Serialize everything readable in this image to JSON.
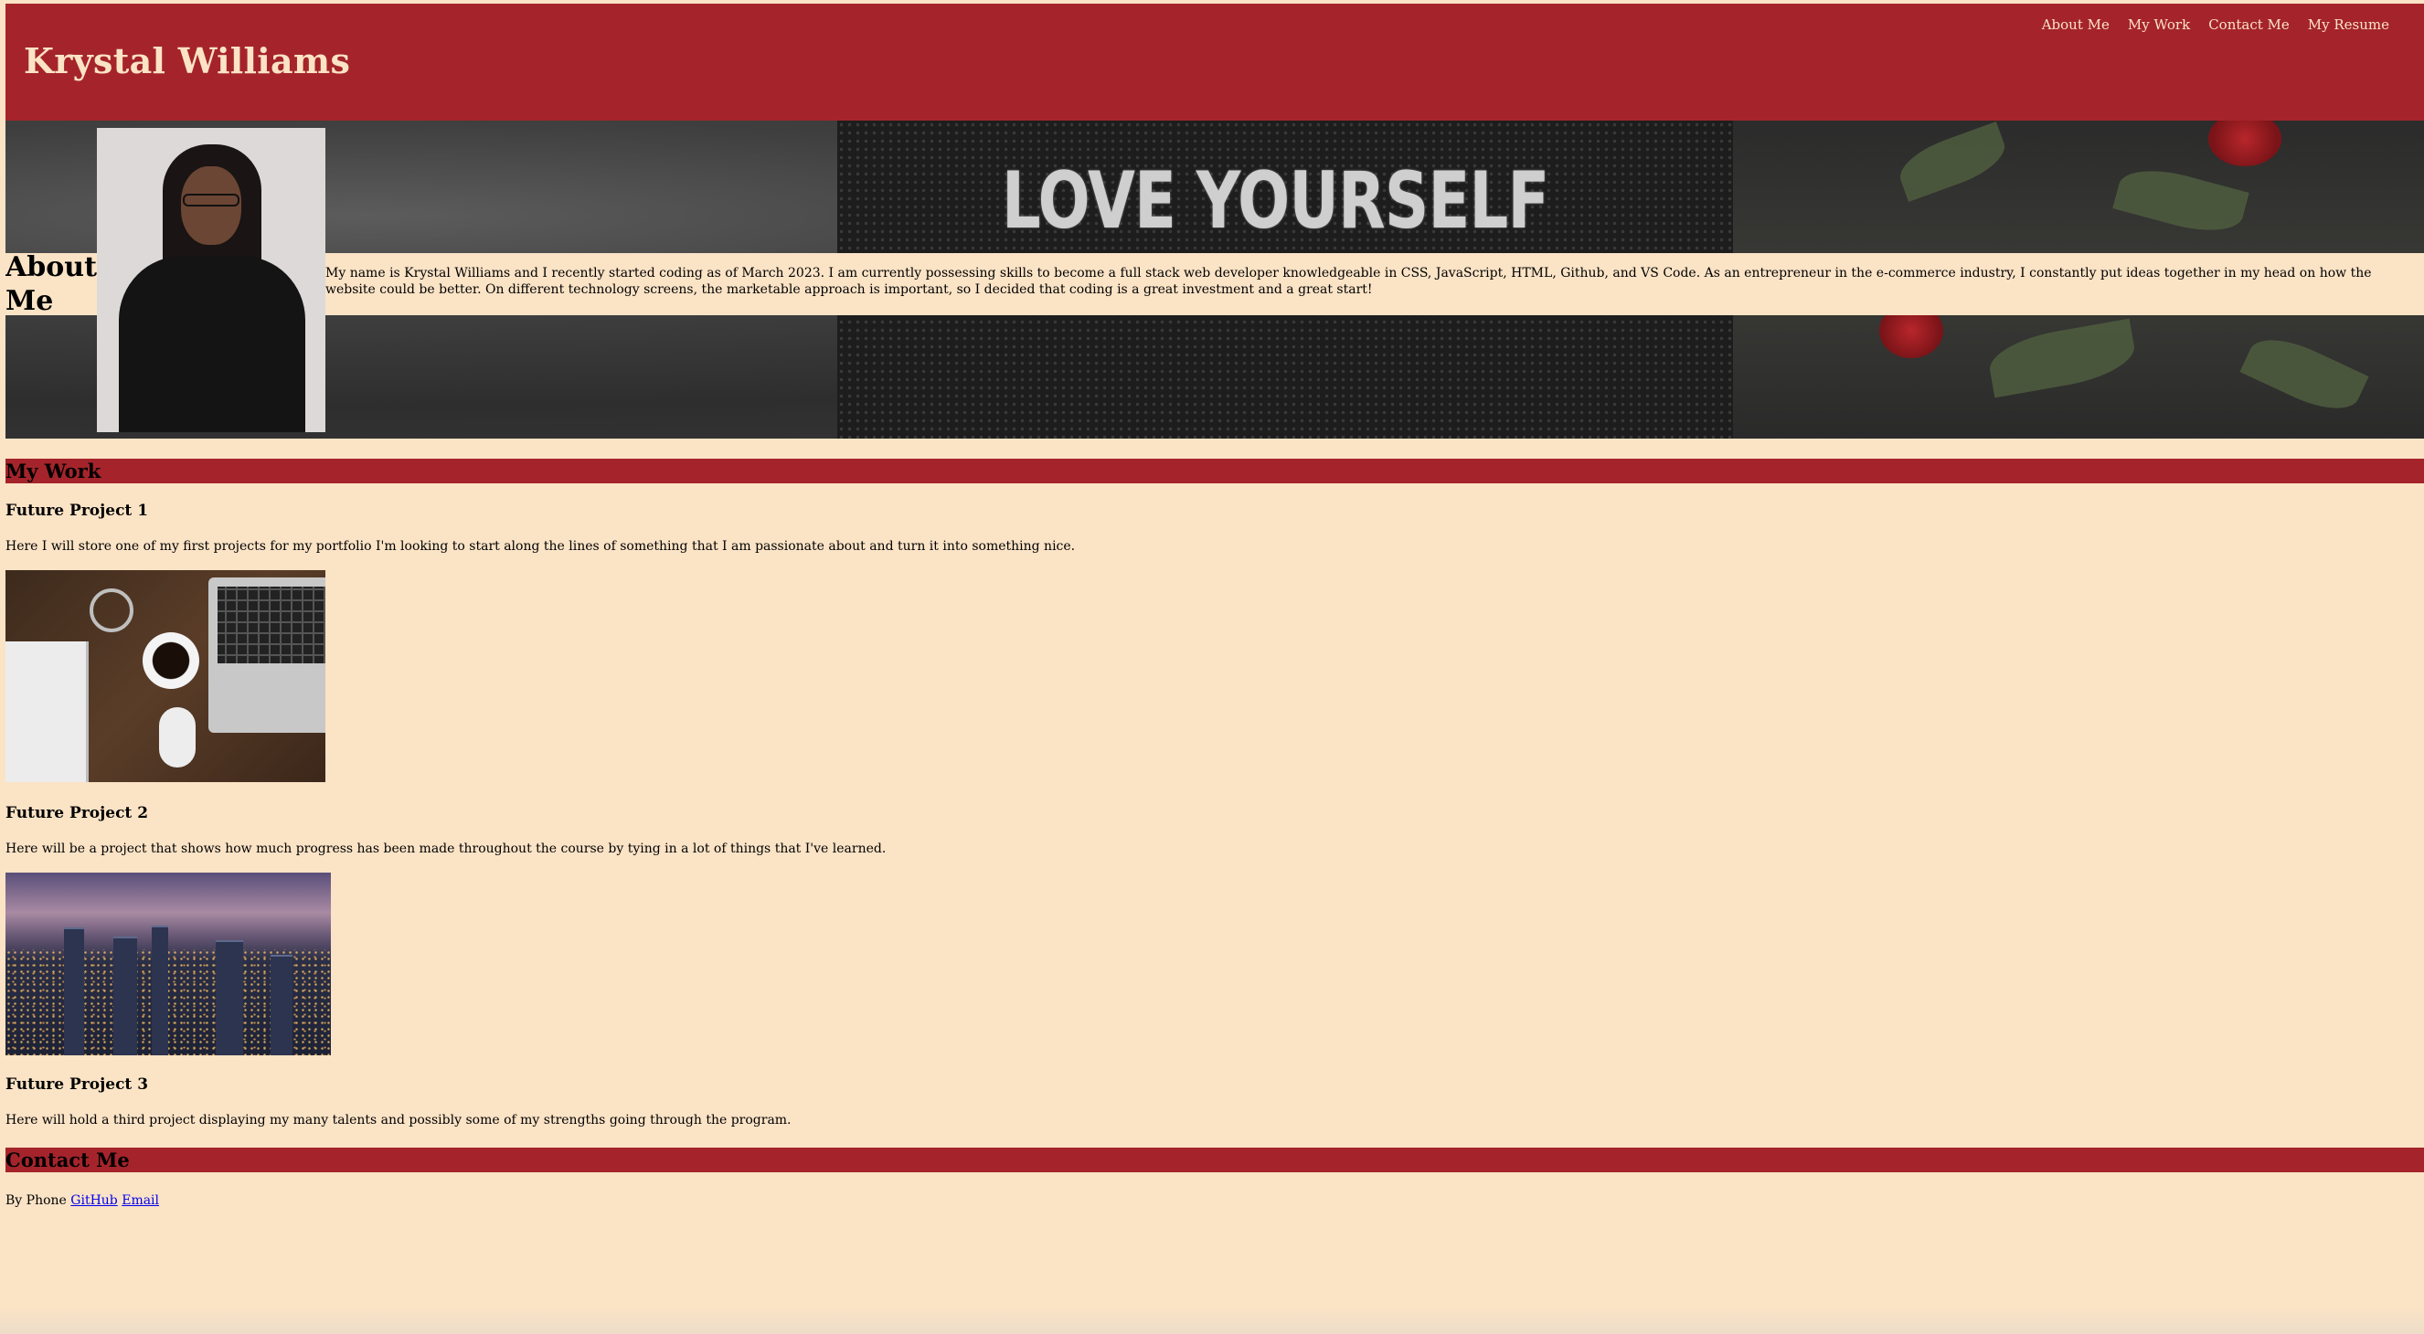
{
  "header": {
    "title": "Krystal Williams",
    "nav": [
      "About Me",
      "My Work",
      "Contact Me",
      "My Resume"
    ]
  },
  "hero": {
    "banner_text": "LOVE YOURSELF"
  },
  "about": {
    "title": "About Me",
    "text": "My name is Krystal Williams and I recently started coding as of March 2023. I am currently possessing skills to become a full stack web developer knowledgeable in CSS, JavaScript, HTML, Github, and VS Code. As an entrepreneur in the e-commerce industry, I constantly put ideas together in my head on how the website could be better. On different technology screens, the marketable approach is important, so I decided that coding is a great investment and a great start!"
  },
  "work": {
    "title": "My Work",
    "projects": [
      {
        "title": "Future Project 1",
        "text": "Here I will store one of my first projects for my portfolio I'm looking to start along the lines of something that I am passionate about and turn it into something nice."
      },
      {
        "title": "Future Project 2",
        "text": "Here will be a project that shows how much progress has been made throughout the course by tying in a lot of things that I've learned."
      },
      {
        "title": "Future Project 3",
        "text": "Here will hold a third project displaying my many talents and possibly some of my strengths going through the program."
      }
    ]
  },
  "contact": {
    "title": "Contact Me",
    "phone_label": "By Phone",
    "links": [
      "GitHub",
      "Email"
    ]
  },
  "colors": {
    "brand_red": "#a5242b",
    "background_cream": "#fbe3c6",
    "link_blue": "#0000ee"
  }
}
